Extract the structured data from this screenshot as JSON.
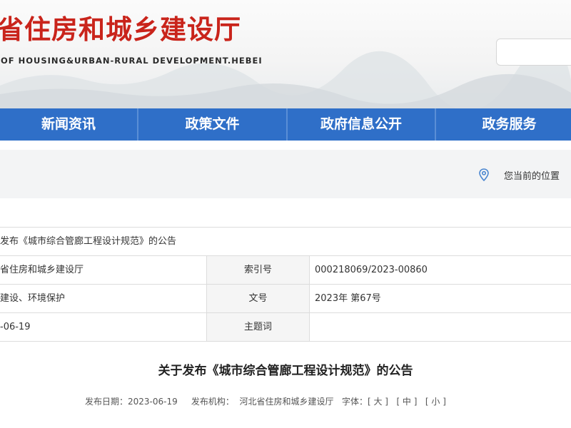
{
  "header": {
    "title": "省住房和城乡建设厅",
    "subtitle": "OF HOUSING&URBAN-RURAL DEVELOPMENT.HEBEI",
    "search_placeholder": ""
  },
  "nav": {
    "items": [
      {
        "label": "新闻资讯"
      },
      {
        "label": "政策文件"
      },
      {
        "label": "政府信息公开"
      },
      {
        "label": "政务服务"
      }
    ]
  },
  "breadcrumb": {
    "location_label": "您当前的位置"
  },
  "info": {
    "title_value": "发布《城市综合管廊工程设计规范》的公告",
    "publisher_value": "省住房和城乡建设厅",
    "index_label": "索引号",
    "index_value": "000218069/2023-00860",
    "category_value": "建设、环境保护",
    "doc_no_label": "文号",
    "doc_no_value": "2023年 第67号",
    "date_value": "-06-19",
    "keywords_label": "主题词",
    "keywords_value": ""
  },
  "article": {
    "title": "关于发布《城市综合管廊工程设计规范》的公告",
    "publish_date_label": "发布日期：",
    "publish_date": "2023-06-19",
    "org_label": "发布机构：",
    "org": "河北省住房和城乡建设厅",
    "font_label": "字体：",
    "font_large": "[ 大 ]",
    "font_medium": "[ 中 ]",
    "font_small": "[ 小 ]"
  },
  "colors": {
    "title_red": "#c9241b",
    "nav_blue": "#2f6fc8"
  },
  "icons": {
    "location": "location-pin-icon"
  }
}
